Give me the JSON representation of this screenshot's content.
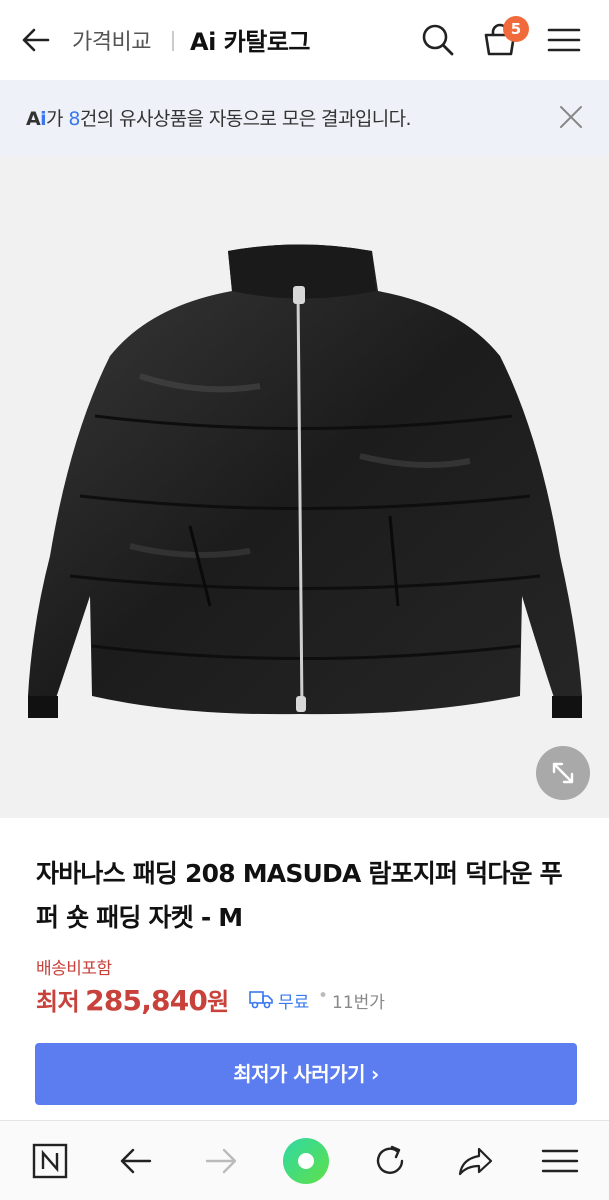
{
  "header": {
    "breadcrumb": "가격비교",
    "title": "Ai 카탈로그",
    "cart_count": "5"
  },
  "banner": {
    "ai_prefix_a": "A",
    "ai_prefix_i": "i",
    "text_before": "가 ",
    "count": "8",
    "text_after": "건의 유사상품을 자동으로 모은 결과입니다."
  },
  "product": {
    "image_icon": "jacket-image",
    "title": "자바나스 패딩 208 MASUDA 람포지퍼 덕다운 푸퍼 숏 패딩 자켓 - M",
    "shipping_note": "배송비포함",
    "price_label": "최저",
    "price_value": "285,840",
    "price_unit": "원",
    "delivery": "무료",
    "separator": "•",
    "store": "11번가"
  },
  "cta": {
    "label": "최저가 사러가기",
    "chevron": "›"
  },
  "navbar": {
    "items": [
      "naver-home-icon",
      "back-arrow-icon",
      "forward-arrow-icon",
      "green-dot-icon",
      "reload-icon",
      "share-icon",
      "menu-icon"
    ]
  },
  "colors": {
    "accent_blue": "#5b7df0",
    "price_red": "#c8413a",
    "badge_orange": "#f06a3c",
    "banner_bg": "#eef2f8"
  }
}
